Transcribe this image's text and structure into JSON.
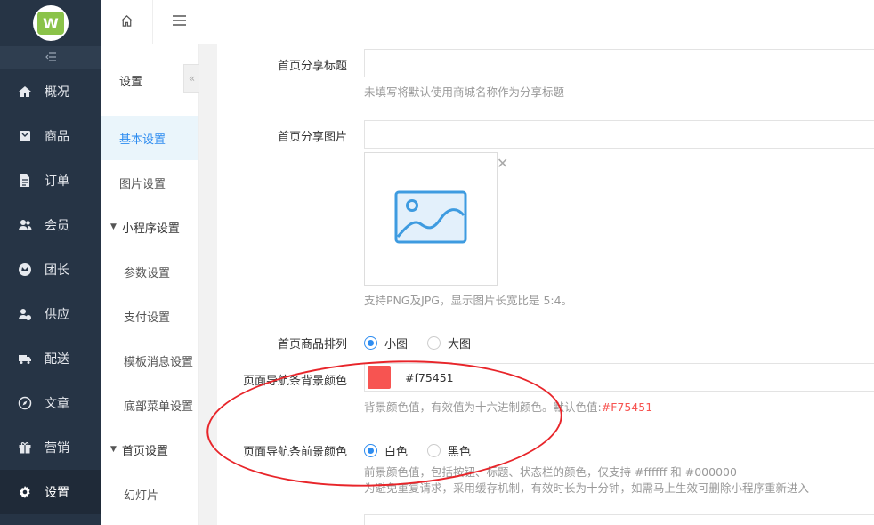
{
  "logo": {
    "letter": "W"
  },
  "sidebar": {
    "collapse_icon": "collapse-icon",
    "items": [
      {
        "label": "概况",
        "icon": "home-icon"
      },
      {
        "label": "商品",
        "icon": "goods-icon"
      },
      {
        "label": "订单",
        "icon": "order-icon"
      },
      {
        "label": "会员",
        "icon": "member-icon"
      },
      {
        "label": "团长",
        "icon": "leader-icon"
      },
      {
        "label": "供应",
        "icon": "supply-icon"
      },
      {
        "label": "配送",
        "icon": "truck-icon"
      },
      {
        "label": "文章",
        "icon": "compass-icon"
      },
      {
        "label": "营销",
        "icon": "gift-icon"
      },
      {
        "label": "设置",
        "icon": "gear-icon"
      }
    ],
    "active": "设置"
  },
  "subnav": {
    "title": "设置",
    "items": [
      {
        "label": "基本设置",
        "type": "item",
        "active": true
      },
      {
        "label": "图片设置",
        "type": "item"
      },
      {
        "label": "小程序设置",
        "type": "group"
      },
      {
        "label": "参数设置",
        "type": "child"
      },
      {
        "label": "支付设置",
        "type": "child"
      },
      {
        "label": "模板消息设置",
        "type": "child"
      },
      {
        "label": "底部菜单设置",
        "type": "child"
      },
      {
        "label": "首页设置",
        "type": "group"
      },
      {
        "label": "幻灯片",
        "type": "child"
      }
    ]
  },
  "form": {
    "share_title": {
      "label": "首页分享标题",
      "value": "",
      "help": "未填写将默认使用商城名称作为分享标题"
    },
    "share_image": {
      "label": "首页分享图片",
      "value": "",
      "help": "支持PNG及JPG，显示图片长宽比是 5:4。"
    },
    "goods_layout": {
      "label": "首页商品排列",
      "options": [
        "小图",
        "大图"
      ],
      "selected": "小图"
    },
    "nav_bg_color": {
      "label": "页面导航条背景颜色",
      "value": "#f75451",
      "help_prefix": "背景颜色值，有效值为十六进制颜色。默认色值:",
      "help_default": "#F75451"
    },
    "nav_fg_color": {
      "label": "页面导航条前景颜色",
      "options": [
        "白色",
        "黑色"
      ],
      "selected": "白色",
      "help1": "前景颜色值，包括按钮、标题、状态栏的颜色，仅支持 #ffffff 和 #000000",
      "help2": "为避免重复请求，采用缓存机制，有效时长为十分钟，如需马上生效可删除小程序重新进入"
    }
  },
  "colors": {
    "accent": "#2d8cf0",
    "swatch": "#f75451",
    "annotation": "#e8252a",
    "sidebar_bg": "#263445"
  }
}
